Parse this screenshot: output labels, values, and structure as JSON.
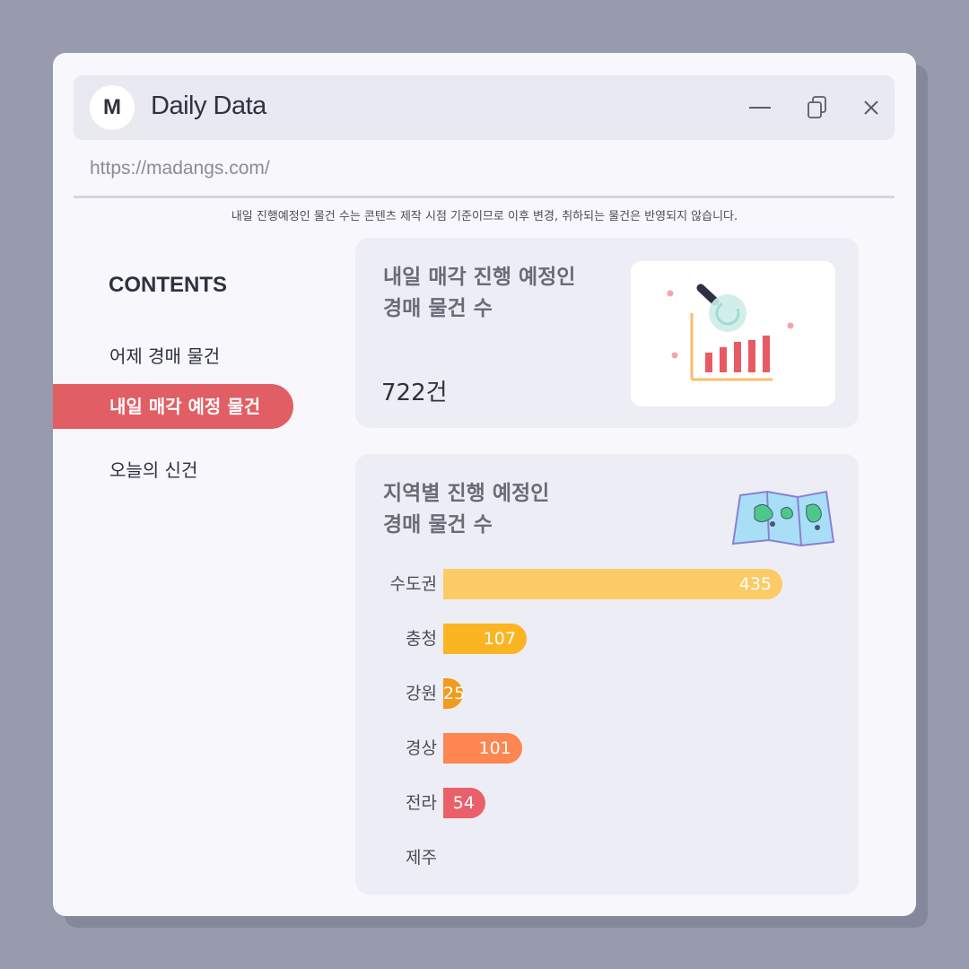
{
  "window": {
    "logo_letter": "M",
    "title": "Daily Data",
    "controls": [
      "minimize-icon",
      "copy-icon",
      "close-icon"
    ],
    "url": "https://madangs.com/"
  },
  "notice": "내일 진행예정인 물건 수는 콘텐츠 제작 시점 기준이므로 이후 변경, 취하되는 물건은 반영되지 않습니다.",
  "sidebar": {
    "heading": "CONTENTS",
    "items": [
      {
        "label": "어제 경매 물건",
        "active": false
      },
      {
        "label": "내일 매각 예정 물건",
        "active": true
      },
      {
        "label": "오늘의 신건",
        "active": false
      }
    ]
  },
  "summary_card": {
    "title_line1": "내일 매각 진행 예정인",
    "title_line2": "경매 물건 수",
    "count": "722건",
    "illustration": "chart-magnifier-icon"
  },
  "region_card": {
    "title_line1": "지역별 진행 예정인",
    "title_line2": "경매 물건 수",
    "illustration": "map-icon"
  },
  "chart_data": {
    "type": "bar",
    "orientation": "horizontal",
    "categories": [
      "수도권",
      "충청",
      "강원",
      "경상",
      "전라",
      "제주"
    ],
    "values": [
      435,
      107,
      25,
      101,
      54,
      0
    ],
    "value_labels": [
      "435",
      "107",
      "25",
      "101",
      "54",
      ""
    ],
    "colors": [
      "#fdcb65",
      "#fbb522",
      "#f09c1e",
      "#fd8651",
      "#e9606a",
      "#cccccc"
    ]
  }
}
